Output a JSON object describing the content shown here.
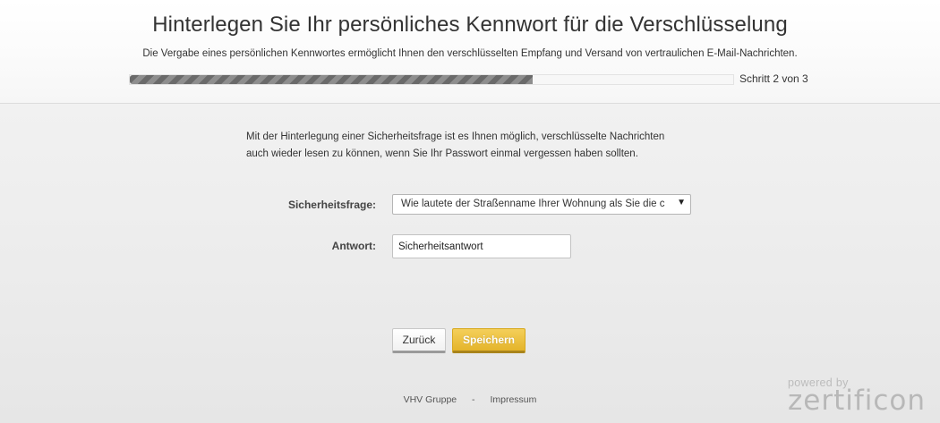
{
  "header": {
    "title": "Hinterlegen Sie Ihr persönliches Kennwort für die Verschlüsselung",
    "subtitle": "Die Vergabe eines persönlichen Kennwortes ermöglicht Ihnen den verschlüsselten Empfang und Versand von vertraulichen E-Mail-Nachrichten.",
    "progress_fraction": 0.667,
    "step_label": "Schritt 2 von 3"
  },
  "intro": {
    "line1": "Mit der Hinterlegung einer Sicherheitsfrage ist es Ihnen möglich, verschlüsselte Nachrichten",
    "line2": "auch wieder lesen zu können, wenn Sie Ihr Passwort einmal vergessen haben sollten."
  },
  "form": {
    "question_label": "Sicherheitsfrage:",
    "question_value": "Wie lautete der Straßenname Ihrer Wohnung als Sie die c",
    "answer_label": "Antwort:",
    "answer_value": "Sicherheitsantwort"
  },
  "buttons": {
    "back_label": "Zurück",
    "save_label": "Speichern"
  },
  "footer": {
    "company": "VHV Gruppe",
    "separator": "-",
    "imprint": "Impressum"
  },
  "branding": {
    "powered_by": "powered by",
    "brand": "zertificon"
  },
  "colors": {
    "accent_button": "#e8b935",
    "progress_fill": "#7a7a7a"
  }
}
